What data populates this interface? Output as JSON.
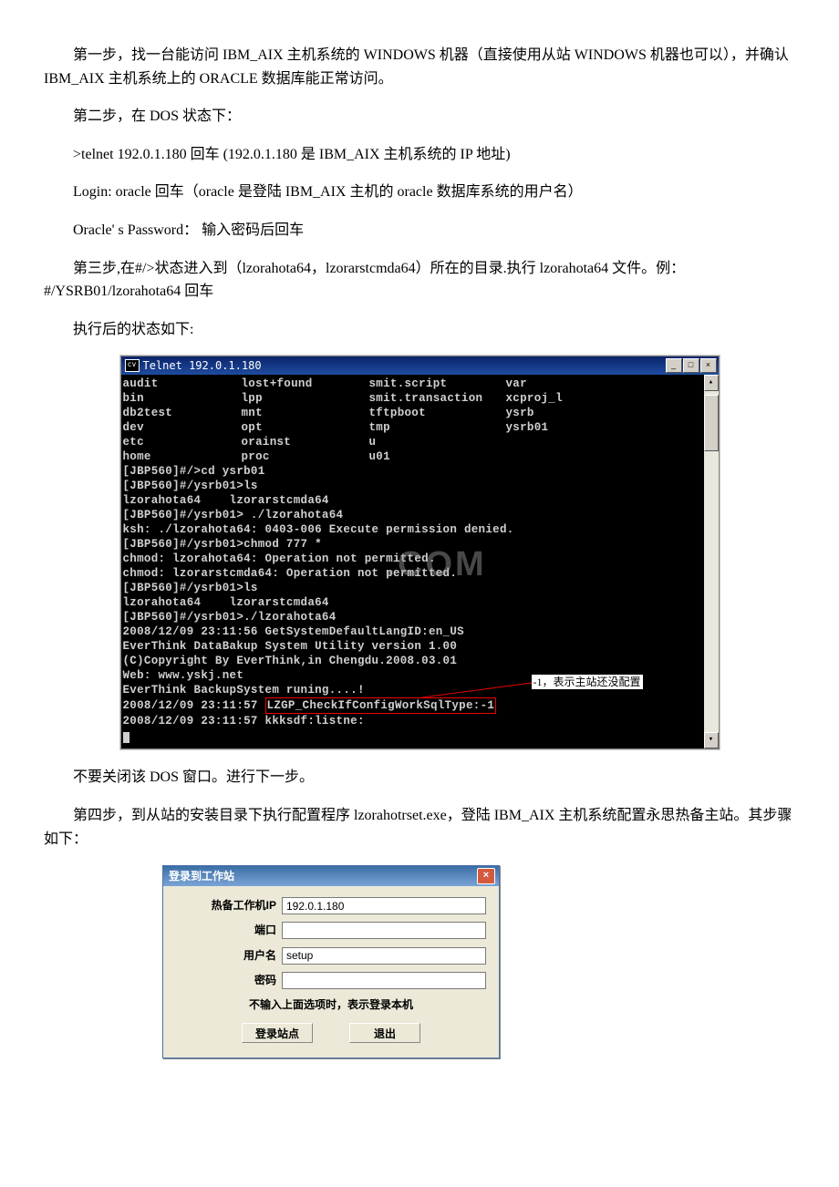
{
  "paragraphs": {
    "p1": "第一步，找一台能访问 IBM_AIX 主机系统的 WINDOWS 机器（直接使用从站 WINDOWS 机器也可以），并确认 IBM_AIX 主机系统上的 ORACLE 数据库能正常访问。",
    "p2": "第二步，在 DOS 状态下：",
    "p3": ">telnet 192.0.1.180 回车 (192.0.1.180 是 IBM_AIX 主机系统的 IP 地址)",
    "p4": "Login: oracle 回车（oracle 是登陆 IBM_AIX 主机的 oracle 数据库系统的用户名）",
    "p5": "Oracle' s Password： 输入密码后回车",
    "p6": "第三步,在#/>状态进入到（lzorahota64，lzorarstcmda64）所在的目录.执行 lzorahota64 文件。例：#/YSRB01/lzorahota64 回车",
    "p7": "执行后的状态如下:",
    "p8": "不要关闭该 DOS 窗口。进行下一步。",
    "p9": "第四步，到从站的安装目录下执行配置程序 lzorahotrset.exe，登陆 IBM_AIX 主机系统配置永思热备主站。其步骤如下："
  },
  "telnet": {
    "title_prefix": "cv",
    "title": "Telnet 192.0.1.180",
    "dir_rows": [
      [
        "audit",
        "lost+found",
        "smit.script",
        "var"
      ],
      [
        "bin",
        "lpp",
        "smit.transaction",
        "xcproj_l"
      ],
      [
        "db2test",
        "mnt",
        "tftpboot",
        "ysrb"
      ],
      [
        "dev",
        "opt",
        "tmp",
        "ysrb01"
      ],
      [
        "etc",
        "orainst",
        "u",
        ""
      ],
      [
        "home",
        "proc",
        "u01",
        ""
      ]
    ],
    "lines_a": [
      "[JBP560]#/>cd ysrb01",
      "[JBP560]#/ysrb01>ls",
      "lzorahota64    lzorarstcmda64",
      "[JBP560]#/ysrb01> ./lzorahota64",
      "ksh: ./lzorahota64: 0403-006 Execute permission denied.",
      "[JBP560]#/ysrb01>chmod 777 *",
      "chmod: lzorahota64: Operation not permitted.",
      "chmod: lzorarstcmda64: Operation not permitted.",
      "[JBP560]#/ysrb01>ls",
      "lzorahota64    lzorarstcmda64",
      "[JBP560]#/ysrb01>./lzorahota64",
      "2008/12/09 23:11:56 GetSystemDefaultLangID:en_US",
      "EverThink DataBakup System Utility version 1.00",
      "(C)Copyright By EverThink,in Chengdu.2008.03.01",
      "Web: www.yskj.net",
      "EverThink BackupSystem runing....!"
    ],
    "red_prefix": "2008/12/09 23:11:57 ",
    "red_text": "LZGP_CheckIfConfigWorkSqlType:-1",
    "lines_b": [
      "2008/12/09 23:11:57 kkksdf:listne:"
    ],
    "annotation": "-1，表示主站还没配置",
    "watermark": ".COM"
  },
  "login": {
    "title": "登录到工作站",
    "labels": {
      "ip": "热备工作机IP",
      "port": "端口",
      "user": "用户名",
      "pwd": "密码"
    },
    "values": {
      "ip": "192.0.1.180",
      "port": "",
      "user": "setup",
      "pwd": ""
    },
    "note": "不输入上面选项时，表示登录本机",
    "btn_login": "登录站点",
    "btn_exit": "退出"
  }
}
